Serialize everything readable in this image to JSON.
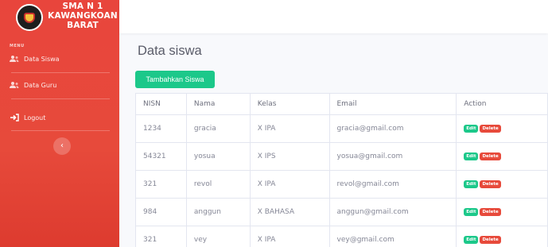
{
  "brand": {
    "line1": "SMA N 1",
    "line2": "KAWANGKOAN",
    "line3": "BARAT"
  },
  "sidebar": {
    "heading": "MENU",
    "items": [
      {
        "label": "Data Siswa",
        "icon": "users-icon"
      },
      {
        "label": "Data Guru",
        "icon": "users-icon"
      },
      {
        "label": "Logout",
        "icon": "logout-icon"
      }
    ],
    "toggle": "‹"
  },
  "main": {
    "title": "Data siswa",
    "add_button": "Tambahkan Siswa",
    "columns": [
      "NISN",
      "Nama",
      "Kelas",
      "Email",
      "Action"
    ],
    "rows": [
      {
        "nisn": "1234",
        "nama": "gracia",
        "kelas": "X IPA",
        "email": "gracia@gmail.com"
      },
      {
        "nisn": "54321",
        "nama": "yosua",
        "kelas": "X IPS",
        "email": "yosua@gmail.com"
      },
      {
        "nisn": "321",
        "nama": "revol",
        "kelas": "X IPA",
        "email": "revol@gmail.com"
      },
      {
        "nisn": "984",
        "nama": "anggun",
        "kelas": "X BAHASA",
        "email": "anggun@gmail.com"
      },
      {
        "nisn": "321",
        "nama": "vey",
        "kelas": "X IPA",
        "email": "vey@gmail.com"
      }
    ],
    "edit_label": "Edit",
    "delete_label": "Delete"
  },
  "colors": {
    "sidebar": "#e74a3b",
    "success": "#1cc88a",
    "danger": "#e74a3b"
  }
}
